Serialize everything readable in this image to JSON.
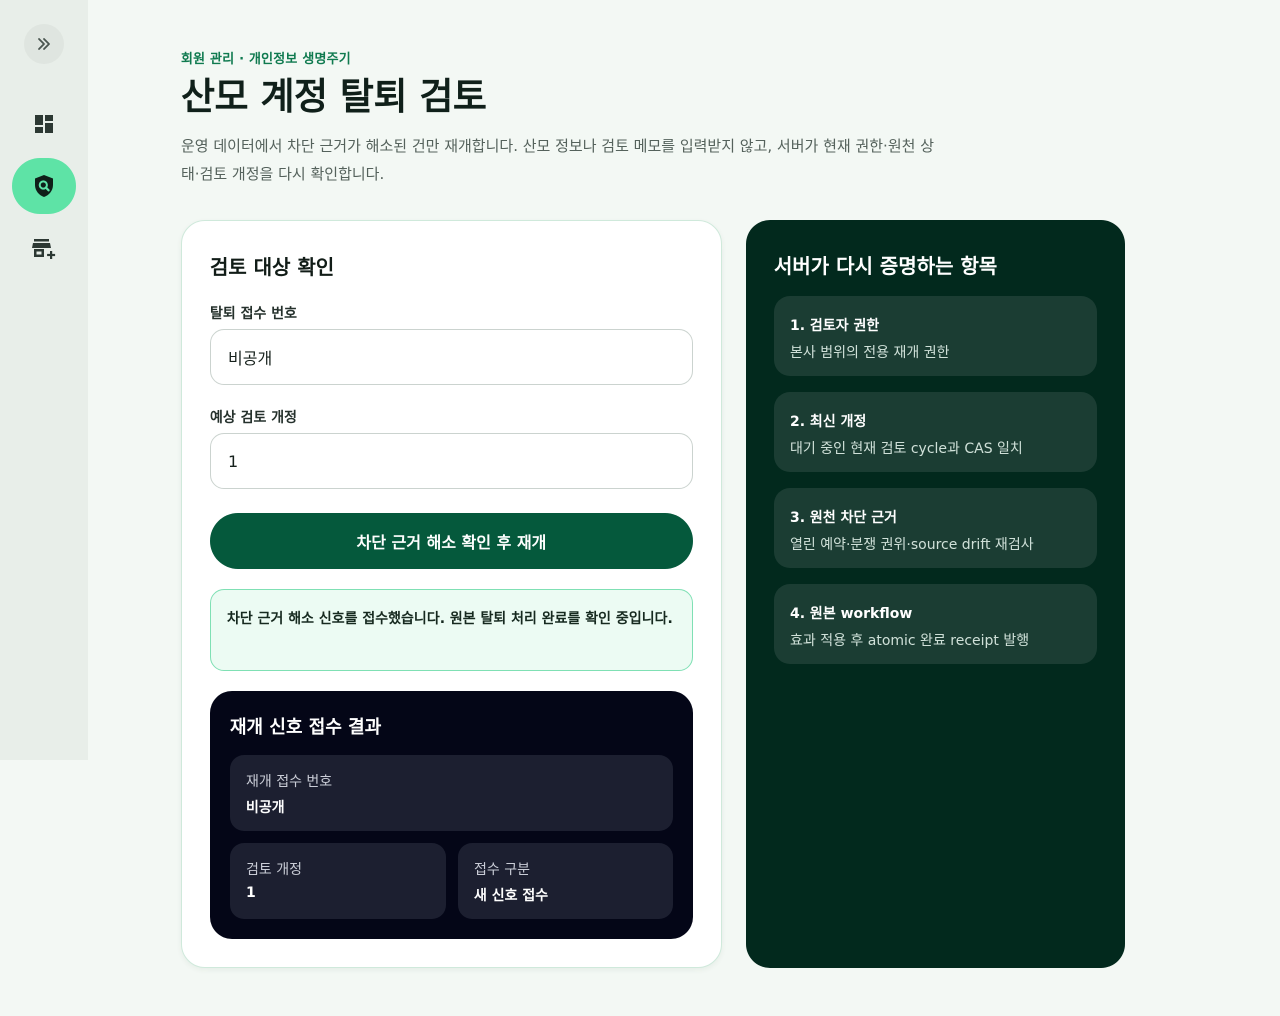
{
  "sidebar": {
    "expand_icon": "chevron-double-right-icon",
    "items": [
      {
        "id": "dashboard",
        "icon": "dashboard-icon",
        "active": false
      },
      {
        "id": "privacy",
        "icon": "shield-search-icon",
        "active": true
      },
      {
        "id": "store",
        "icon": "store-add-icon",
        "active": false
      }
    ]
  },
  "header": {
    "breadcrumb": "회원 관리 · 개인정보 생명주기",
    "title": "산모 계정 탈퇴 검토",
    "description": "운영 데이터에서 차단 근거가 해소된 건만 재개합니다. 산모 정보나 검토 메모를 입력받지 않고, 서버가 현재 권한·원천 상태·검토 개정을 다시 확인합니다."
  },
  "form": {
    "title": "검토 대상 확인",
    "receipt_label": "탈퇴 접수 번호",
    "receipt_value": "비공개",
    "revision_label": "예상 검토 개정",
    "revision_value": "1",
    "submit_label": "차단 근거 해소 확인 후 재개",
    "notice": "차단 근거 해소 신호를 접수했습니다. 원본 탈퇴 처리 완료를 확인 중입니다."
  },
  "result": {
    "title": "재개 신호 접수 결과",
    "resume_receipt_label": "재개 접수 번호",
    "resume_receipt_value": "비공개",
    "revision_label": "검토 개정",
    "revision_value": "1",
    "type_label": "접수 구분",
    "type_value": "새 신호 접수"
  },
  "checks": {
    "title": "서버가 다시 증명하는 항목",
    "items": [
      {
        "title": "1. 검토자 권한",
        "desc": "본사 범위의 전용 재개 권한"
      },
      {
        "title": "2. 최신 개정",
        "desc": "대기 중인 현재 검토 cycle과 CAS 일치"
      },
      {
        "title": "3. 원천 차단 근거",
        "desc": "열린 예약·분쟁 권위·source drift 재검사"
      },
      {
        "title": "4. 원본 workflow",
        "desc": "효과 적용 후 atomic 완료 receipt 발행"
      }
    ]
  },
  "colors": {
    "accent": "#05593c",
    "active_nav": "#5ee3a6",
    "panel_dark": "#02291d",
    "result_dark": "#040617"
  }
}
